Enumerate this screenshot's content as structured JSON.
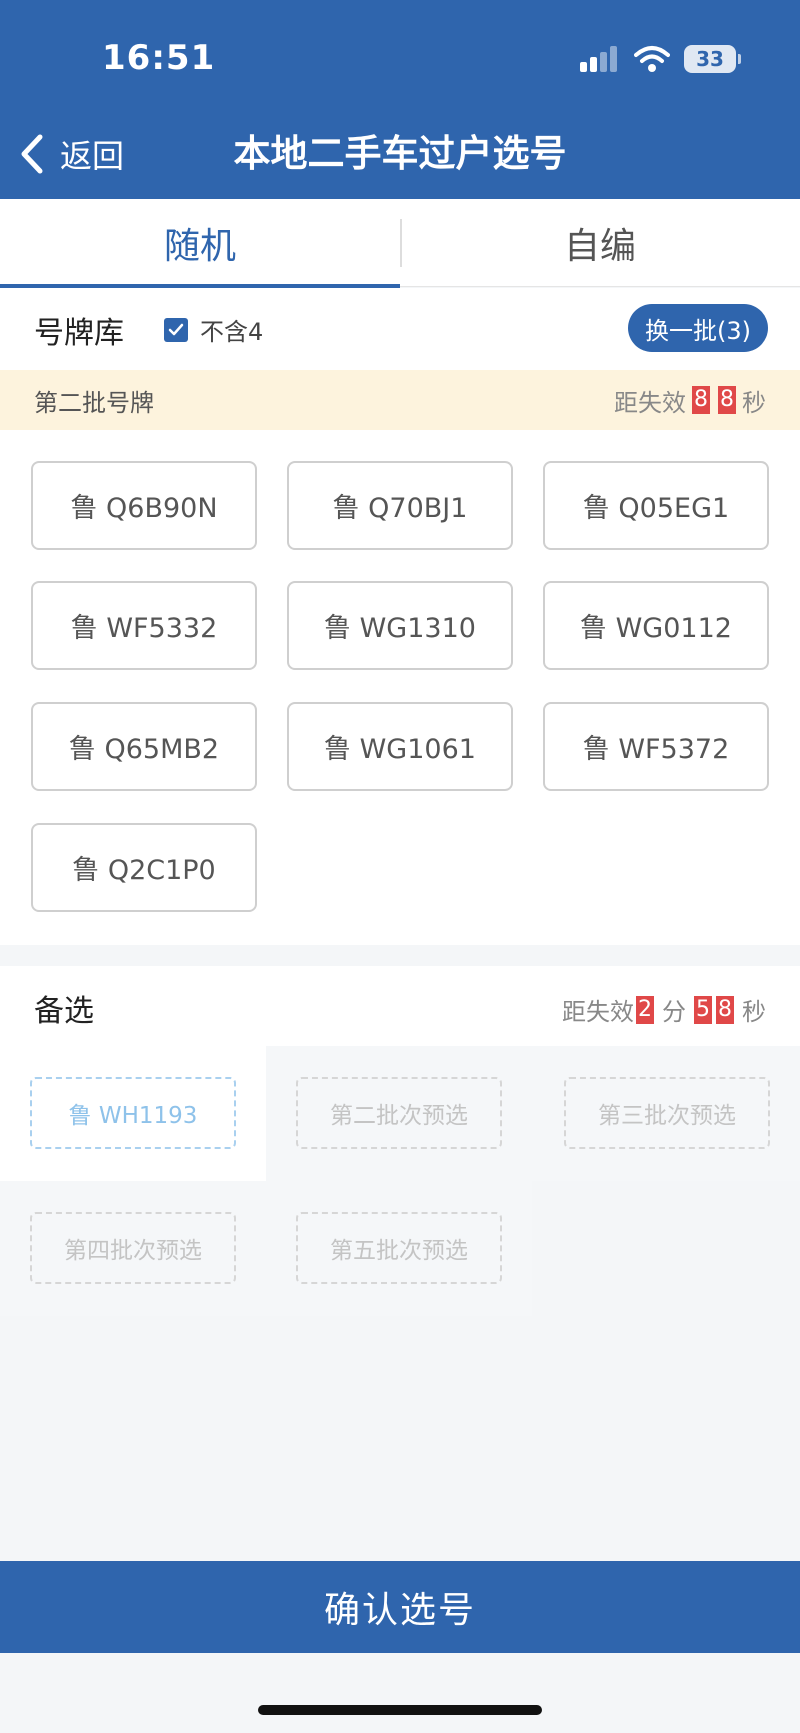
{
  "status_bar": {
    "time": "16:51",
    "battery": "33"
  },
  "nav": {
    "back_label": "返回",
    "title": "本地二手车过户选号"
  },
  "tabs": [
    {
      "label": "随机",
      "active": true
    },
    {
      "label": "自编",
      "active": false
    }
  ],
  "pool": {
    "title": "号牌库",
    "exclude_four_label": "不含4",
    "exclude_four_checked": true,
    "refresh_label": "换一批(3)"
  },
  "batch": {
    "label": "第二批号牌",
    "countdown_prefix": "距失效",
    "seconds_digits": [
      "8",
      "8"
    ],
    "seconds_unit": "秒"
  },
  "plates": [
    "鲁 Q6B90N",
    "鲁 Q70BJ1",
    "鲁 Q05EG1",
    "鲁 WF5332",
    "鲁 WG1310",
    "鲁 WG0112",
    "鲁 Q65MB2",
    "鲁 WG1061",
    "鲁 WF5372",
    "鲁 Q2C1P0"
  ],
  "backup": {
    "title": "备选",
    "countdown_prefix": "距失效",
    "minutes_digit": "2",
    "minutes_unit": "分",
    "seconds_digits": [
      "5",
      "8"
    ],
    "seconds_unit": "秒",
    "slots": [
      {
        "text": "鲁 WH1193",
        "filled": true
      },
      {
        "text": "第二批次预选",
        "filled": false
      },
      {
        "text": "第三批次预选",
        "filled": false
      },
      {
        "text": "第四批次预选",
        "filled": false
      },
      {
        "text": "第五批次预选",
        "filled": false
      }
    ]
  },
  "confirm_label": "确认选号",
  "colors": {
    "primary": "#2f65ad",
    "countdown_digit": "#e04848",
    "banner_bg": "#fdf3dd"
  }
}
